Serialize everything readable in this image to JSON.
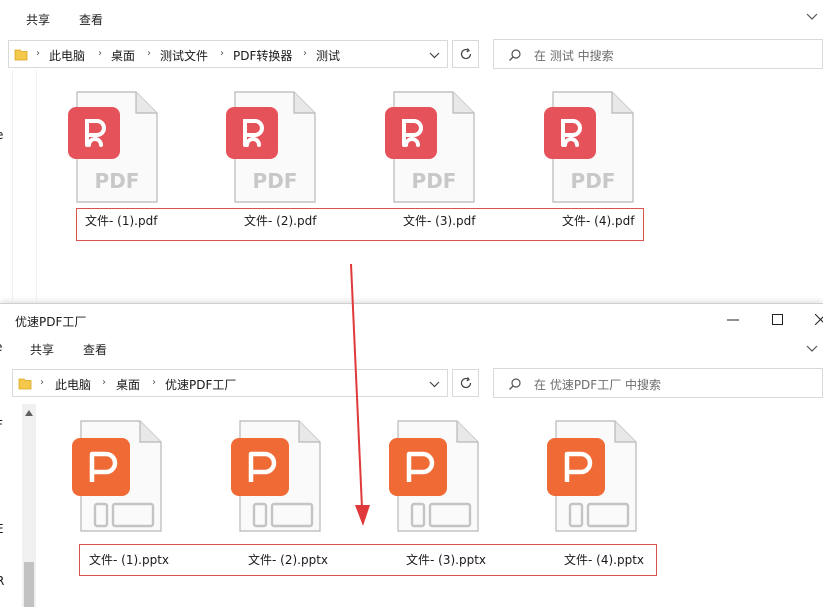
{
  "window1": {
    "ribbon": {
      "share": "共享",
      "view": "查看"
    },
    "breadcrumb": [
      "此电脑",
      "桌面",
      "测试文件",
      "PDF转换器",
      "测试"
    ],
    "search_placeholder": "在 测试 中搜索",
    "files": [
      {
        "name": "文件- (1).pdf",
        "type": "pdf"
      },
      {
        "name": "文件- (2).pdf",
        "type": "pdf"
      },
      {
        "name": "文件- (3).pdf",
        "type": "pdf"
      },
      {
        "name": "文件- (4).pdf",
        "type": "pdf"
      }
    ],
    "sidebar_fragment": "e"
  },
  "window2": {
    "title": "优速PDF工厂",
    "ribbon": {
      "share": "共享",
      "view": "查看"
    },
    "breadcrumb": [
      "此电脑",
      "桌面",
      "优速PDF工厂"
    ],
    "search_placeholder": "在 优速PDF工厂 中搜索",
    "files": [
      {
        "name": "文件- (1).pptx",
        "type": "pptx"
      },
      {
        "name": "文件- (2).pptx",
        "type": "pptx"
      },
      {
        "name": "文件- (3).pptx",
        "type": "pptx"
      },
      {
        "name": "文件- (4).pptx",
        "type": "pptx"
      }
    ],
    "sidebar_fragments": [
      "F",
      "E",
      "e",
      "R"
    ]
  },
  "icons": {
    "folder": "folder-icon",
    "refresh": "refresh-icon",
    "search": "search-icon",
    "chevron": "chevron-down-icon",
    "minimize": "minimize-icon",
    "maximize": "maximize-icon",
    "close": "close-icon",
    "pdf_badge": "pdf-app-icon",
    "pptx_badge": "pptx-app-icon",
    "arrow": "red-arrow-icon"
  },
  "colors": {
    "pdf_badge": "#e5525a",
    "pptx_badge": "#f06a35",
    "highlight_box": "#d9534f",
    "arrow": "#e0393a"
  }
}
